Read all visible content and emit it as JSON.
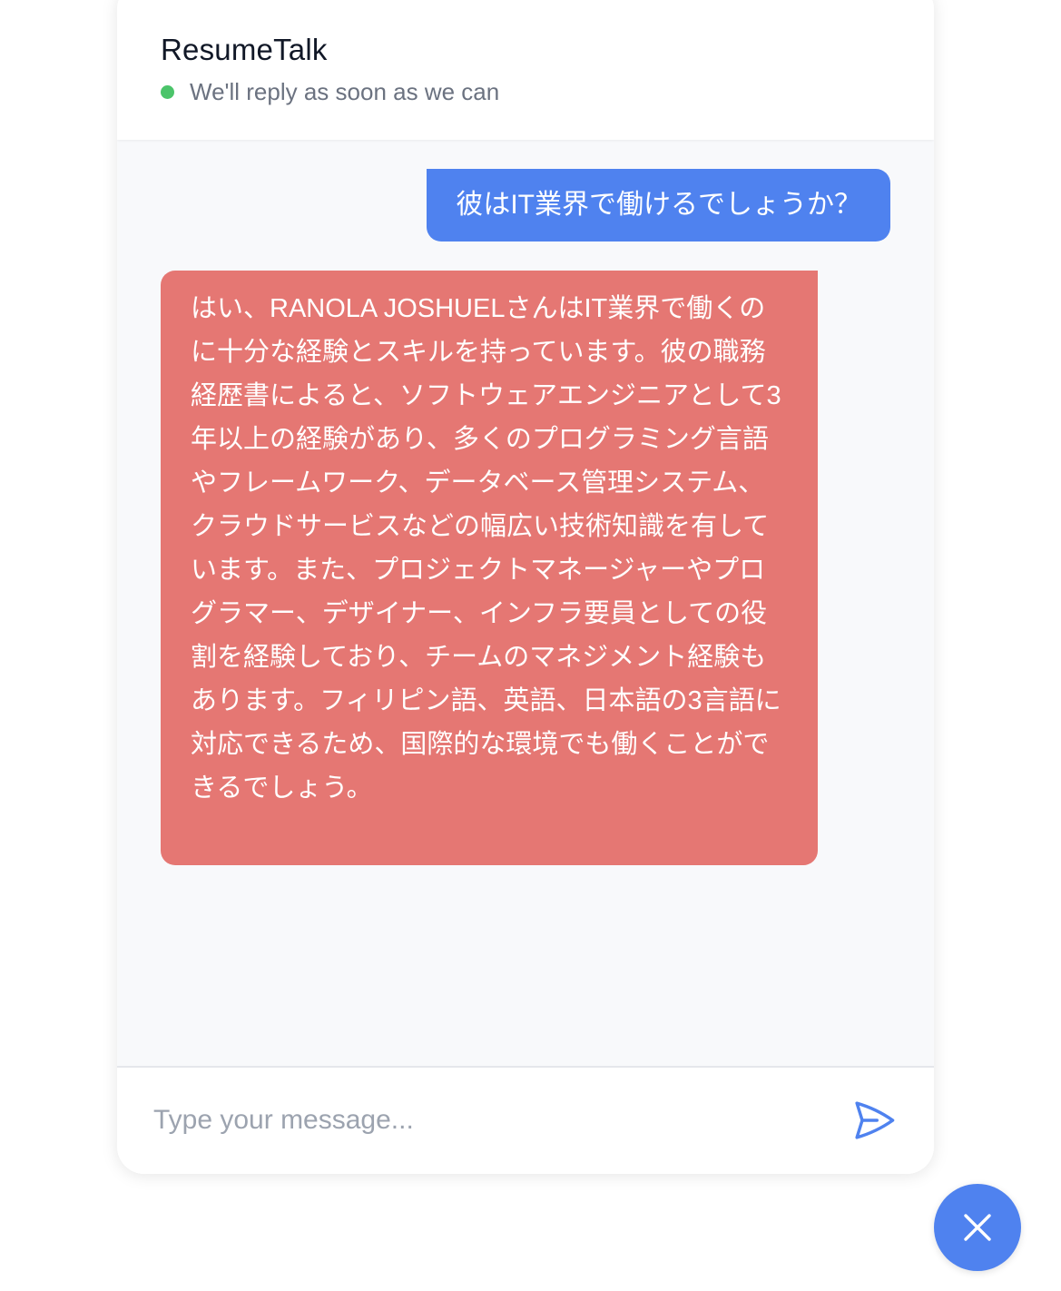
{
  "colors": {
    "accent": "#4f82ef",
    "bot_bubble": "#e57773",
    "status_online": "#4bc46a"
  },
  "header": {
    "title": "ResumeTalk",
    "status_text": "We'll reply as soon as we can"
  },
  "messages": [
    {
      "sender": "user",
      "text": "彼はIT業界で働けるでしょうか？"
    },
    {
      "sender": "bot",
      "text": "はい、RANOLA JOSHUELさんはIT業界で働くのに十分な経験とスキルを持っています。彼の職務経歴書によると、ソフトウェアエンジニアとして3年以上の経験があり、多くのプログラミング言語やフレームワーク、データベース管理システム、クラウドサービスなどの幅広い技術知識を有しています。また、プロジェクトマネージャーやプログラマー、デザイナー、インフラ要員としての役割を経験しており、チームのマネジメント経験もあります。フィリピン語、英語、日本語の3言語に対応できるため、国際的な環境でも働くことができるでしょう。"
    }
  ],
  "input": {
    "placeholder": "Type your message...",
    "value": ""
  },
  "icons": {
    "send": "paper-plane-icon",
    "close": "close-icon"
  }
}
